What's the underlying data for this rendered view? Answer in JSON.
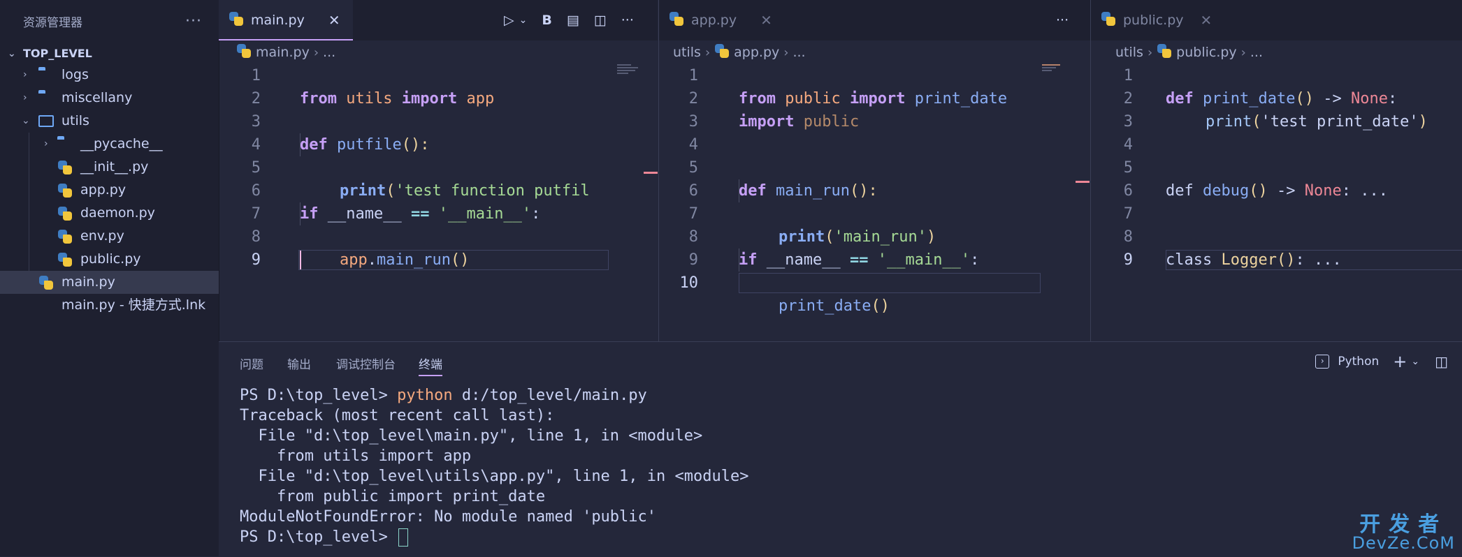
{
  "sidebar": {
    "title": "资源管理器",
    "more": "···",
    "root": "TOP_LEVEL",
    "items": [
      {
        "label": "logs",
        "kind": "folder"
      },
      {
        "label": "miscellany",
        "kind": "folder"
      },
      {
        "label": "utils",
        "kind": "folder-open"
      },
      {
        "label": "__pycache__",
        "kind": "folder"
      },
      {
        "label": "__init__.py",
        "kind": "python"
      },
      {
        "label": "app.py",
        "kind": "python"
      },
      {
        "label": "daemon.py",
        "kind": "python"
      },
      {
        "label": "env.py",
        "kind": "python"
      },
      {
        "label": "public.py",
        "kind": "python"
      },
      {
        "label": "main.py",
        "kind": "python",
        "selected": true
      },
      {
        "label": "main.py - 快捷方式.lnk",
        "kind": "file"
      }
    ]
  },
  "editors": [
    {
      "tab": "main.py",
      "close": "✕",
      "tools": {
        "run": "▷",
        "run_menu": "⌄",
        "bold": "B",
        "preview": "▤",
        "split": "◫",
        "more": "···"
      },
      "breadcrumb": [
        "main.py",
        "..."
      ],
      "lines": [
        "1",
        "2",
        "3",
        "4",
        "5",
        "6",
        "7",
        "8",
        "9"
      ]
    },
    {
      "tab": "app.py",
      "close": "✕",
      "tools": {
        "more": "···"
      },
      "breadcrumb": [
        "utils",
        "app.py",
        "..."
      ],
      "lines": [
        "1",
        "2",
        "3",
        "4",
        "5",
        "6",
        "7",
        "8",
        "9",
        "10"
      ]
    },
    {
      "tab": "public.py",
      "close": "✕",
      "breadcrumb": [
        "utils",
        "public.py",
        "..."
      ],
      "lines": [
        "1",
        "2",
        "3",
        "4",
        "5",
        "6",
        "7",
        "8",
        "9"
      ]
    }
  ],
  "code": {
    "main_1a": "from",
    "main_1b": "utils",
    "main_1c": "import",
    "main_1d": "app",
    "main_3a": "def",
    "main_3b": "putfile",
    "main_3c": "():",
    "main_4a": "print",
    "main_4b": "(",
    "main_4c": "'test function putfil",
    "main_6a": "if",
    "main_6b": "__name__",
    "main_6c": "==",
    "main_6d": "'__main__'",
    "main_6e": ":",
    "main_7a": "app",
    "main_7b": ".",
    "main_7c": "main_run",
    "main_7d": "()",
    "app_1a": "from",
    "app_1b": "public",
    "app_1c": "import",
    "app_1d": "print_date",
    "app_2a": "import",
    "app_2b": "public",
    "app_5a": "def",
    "app_5b": "main_run",
    "app_5c": "():",
    "app_6a": "print",
    "app_6b": "(",
    "app_6c": "'main_run'",
    "app_6d": ")",
    "app_8a": "if",
    "app_8b": "__name__",
    "app_8c": "==",
    "app_8d": "'__main__'",
    "app_8e": ":",
    "app_9a": "print_date",
    "app_9b": "()",
    "pub_1a": "def",
    "pub_1b": "print_date",
    "pub_1c": "()",
    "pub_1d": "->",
    "pub_1e": "None",
    "pub_1f": ":",
    "pub_2a": "print",
    "pub_2b": "(",
    "pub_2c": "'test print_date'",
    "pub_2d": ")",
    "pub_5a": "def",
    "pub_5b": "debug",
    "pub_5c": "()",
    "pub_5d": "->",
    "pub_5e": "None",
    "pub_5f": ": ...",
    "pub_8a": "class",
    "pub_8b": "Logger",
    "pub_8c": "()",
    "pub_8d": ": ..."
  },
  "panel": {
    "tabs": [
      "问题",
      "输出",
      "调试控制台",
      "终端"
    ],
    "profile": "Python",
    "add": "+",
    "add_menu": "⌄",
    "split": "◫",
    "terminal": {
      "prompt": "PS D:\\top_level> ",
      "command": "python",
      "args": " d:/top_level/main.py",
      "out1": "Traceback (most recent call last):",
      "out2": "  File \"d:\\top_level\\main.py\", line 1, in <module>",
      "out3": "    from utils import app",
      "out4": "  File \"d:\\top_level\\utils\\app.py\", line 1, in <module>",
      "out5": "    from public import print_date",
      "out6": "ModuleNotFoundError: No module named 'public'",
      "prompt2": "PS D:\\top_level> "
    }
  },
  "watermark": {
    "line1": "开发者",
    "line2": "DevZe.CoM"
  }
}
